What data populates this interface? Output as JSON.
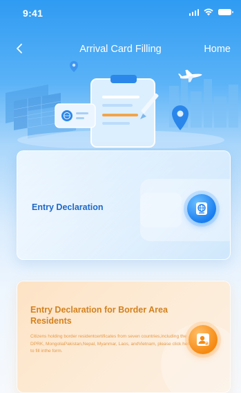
{
  "status_bar": {
    "time": "9:41",
    "icons": [
      "signal-icon",
      "wifi-icon",
      "battery-icon"
    ]
  },
  "nav": {
    "title": "Arrival Card Filling",
    "home_label": "Home",
    "back_icon": "chevron-left-icon"
  },
  "hero": {
    "icons": [
      "clipboard-icon",
      "passport-card-icon",
      "airplane-icon",
      "location-pin-icon",
      "pencil-icon"
    ]
  },
  "cards": {
    "entry": {
      "label": "Entry Declaration",
      "icon": "passport-icon"
    },
    "border": {
      "title": "Entry Declaration for Border Area Residents",
      "description": "Citizens holding border residentcertificates from seven countries,including the DPRK, MongoliaPakistan,Nepal, Myanmar, Laos, andVietnam, please click here to fill inthe form.",
      "icon": "resident-id-icon"
    }
  },
  "colors": {
    "header_blue": "#2f9bf2",
    "entry_label": "#1f68c8",
    "border_title": "#d3811d",
    "border_text": "#e39a4a",
    "badge_blue": "#1a7ef0",
    "badge_orange": "#f58a12"
  }
}
